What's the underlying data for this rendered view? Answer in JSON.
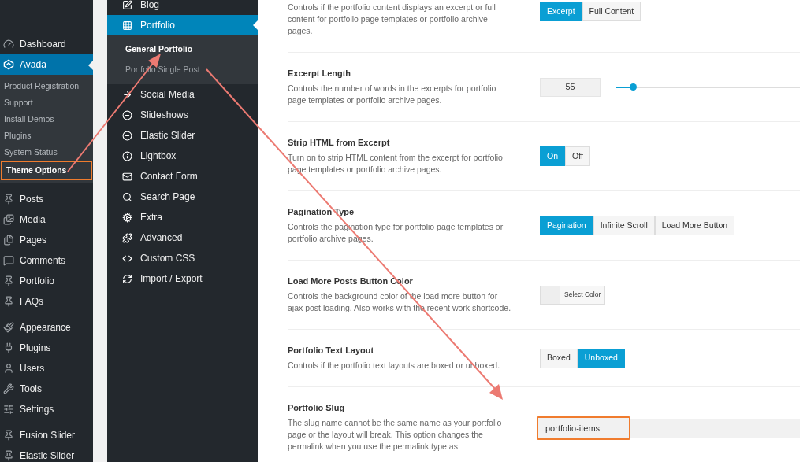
{
  "admin_menu": {
    "groups": [
      [
        {
          "label": "Dashboard",
          "selected": false
        },
        {
          "label": "Avada",
          "selected": true,
          "children": [
            {
              "label": "Product Registration",
              "selected": false,
              "highlighted": false
            },
            {
              "label": "Support",
              "selected": false,
              "highlighted": false
            },
            {
              "label": "Install Demos",
              "selected": false,
              "highlighted": false
            },
            {
              "label": "Plugins",
              "selected": false,
              "highlighted": false
            },
            {
              "label": "System Status",
              "selected": false,
              "highlighted": false
            },
            {
              "label": "Theme Options",
              "selected": true,
              "highlighted": true
            }
          ]
        }
      ],
      [
        {
          "label": "Posts",
          "selected": false
        },
        {
          "label": "Media",
          "selected": false
        },
        {
          "label": "Pages",
          "selected": false
        },
        {
          "label": "Comments",
          "selected": false
        },
        {
          "label": "Portfolio",
          "selected": false
        },
        {
          "label": "FAQs",
          "selected": false
        }
      ],
      [
        {
          "label": "Appearance",
          "selected": false
        },
        {
          "label": "Plugins",
          "selected": false
        },
        {
          "label": "Users",
          "selected": false
        },
        {
          "label": "Tools",
          "selected": false
        },
        {
          "label": "Settings",
          "selected": false
        }
      ],
      [
        {
          "label": "Fusion Slider",
          "selected": false
        },
        {
          "label": "Elastic Slider",
          "selected": false
        }
      ]
    ]
  },
  "options_menu": {
    "items": [
      {
        "label": "Blog",
        "selected": false
      },
      {
        "label": "Portfolio",
        "selected": true,
        "children": [
          {
            "label": "General Portfolio",
            "selected": true
          },
          {
            "label": "Portfolio Single Post",
            "selected": false
          }
        ]
      },
      {
        "label": "Social Media",
        "selected": false
      },
      {
        "label": "Slideshows",
        "selected": false
      },
      {
        "label": "Elastic Slider",
        "selected": false
      },
      {
        "label": "Lightbox",
        "selected": false
      },
      {
        "label": "Contact Form",
        "selected": false
      },
      {
        "label": "Search Page",
        "selected": false
      },
      {
        "label": "Extra",
        "selected": false
      },
      {
        "label": "Advanced",
        "selected": false
      },
      {
        "label": "Custom CSS",
        "selected": false
      },
      {
        "label": "Import / Export",
        "selected": false
      }
    ]
  },
  "options": [
    {
      "kind": "buttonset",
      "description": "Controls if the portfolio content displays an excerpt or full content for portfolio page templates or portfolio archive pages.",
      "choices": [
        {
          "label": "Excerpt",
          "selected": true
        },
        {
          "label": "Full Content",
          "selected": false
        }
      ]
    },
    {
      "kind": "slider",
      "title": "Excerpt Length",
      "description": "Controls the number of words in the excerpts for portfolio page templates or portfolio archive pages.",
      "value": "55",
      "level": 0.09
    },
    {
      "kind": "buttonset",
      "title": "Strip HTML from Excerpt",
      "description": "Turn on to strip HTML content from the excerpt for portfolio page templates or portfolio archive pages.",
      "choices": [
        {
          "label": "On",
          "selected": true
        },
        {
          "label": "Off",
          "selected": false
        }
      ]
    },
    {
      "kind": "buttonset",
      "title": "Pagination Type",
      "description": "Controls the pagination type for portfolio page templates or portfolio archive pages.",
      "choices": [
        {
          "label": "Pagination",
          "selected": true
        },
        {
          "label": "Infinite Scroll",
          "selected": false
        },
        {
          "label": "Load More Button",
          "selected": false
        }
      ]
    },
    {
      "kind": "color",
      "title": "Load More Posts Button Color",
      "description": "Controls the background color of the load more button for ajax post loading. Also works with the recent work shortcode.",
      "button": "Select Color"
    },
    {
      "kind": "buttonset",
      "title": "Portfolio Text Layout",
      "description": "Controls if the portfolio text layouts are boxed or unboxed.",
      "choices": [
        {
          "label": "Boxed",
          "selected": false
        },
        {
          "label": "Unboxed",
          "selected": true
        }
      ]
    },
    {
      "kind": "text",
      "title": "Portfolio Slug",
      "description": "The slug name cannot be the same name as your portfolio page or the layout will break. This option changes the permalink when you use the permalink type as",
      "value": "portfolio-items",
      "highlighted": true
    }
  ]
}
